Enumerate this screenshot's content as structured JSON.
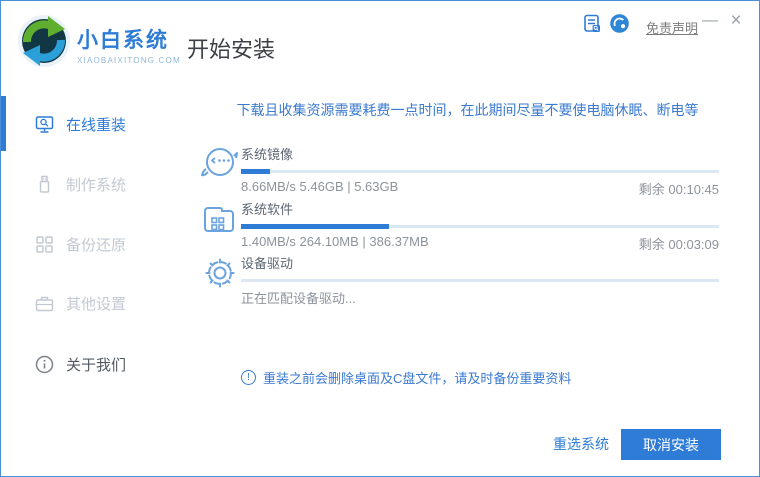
{
  "header": {
    "brand_name": "小白系统",
    "brand_domain": "XIAOBAIXITONG.COM",
    "page_title": "开始安装",
    "disclaimer": "免责声明",
    "minimize": "—",
    "close": "×",
    "icons": {
      "feedback": "document-feedback-icon",
      "service": "customer-service-icon"
    }
  },
  "sidebar": {
    "items": [
      {
        "label": "在线重装",
        "icon": "monitor-reinstall-icon",
        "state": "active"
      },
      {
        "label": "制作系统",
        "icon": "usb-make-system-icon",
        "state": "disabled"
      },
      {
        "label": "备份还原",
        "icon": "backup-restore-icon",
        "state": "disabled"
      },
      {
        "label": "其他设置",
        "icon": "briefcase-settings-icon",
        "state": "disabled"
      },
      {
        "label": "关于我们",
        "icon": "info-about-icon",
        "state": "normal"
      }
    ]
  },
  "main": {
    "notice": "下载且收集资源需要耗费一点时间，在此期间尽量不要使电脑休眠、断电等",
    "tasks": [
      {
        "name": "系统镜像",
        "icon": "mascot-face-icon",
        "progress_percent": 6,
        "detail": "8.66MB/s 5.46GB | 5.63GB",
        "remaining": "剩余 00:10:45"
      },
      {
        "name": "系统软件",
        "icon": "software-folder-icon",
        "progress_percent": 31,
        "detail": "1.40MB/s 264.10MB | 386.37MB",
        "remaining": "剩余 00:03:09"
      },
      {
        "name": "设备驱动",
        "icon": "gear-icon",
        "progress_percent": 0,
        "detail": "正在匹配设备驱动...",
        "remaining": ""
      }
    ],
    "warning_icon": "exclamation-circle-icon",
    "warning": "重装之前会删除桌面及C盘文件，请及时备份重要资料",
    "footer": {
      "reselect": "重选系统",
      "cancel": "取消安装"
    }
  },
  "colors": {
    "accent": "#2e7cd6",
    "notice_blue": "#3a7ad1",
    "progress_track": "#dbe7f3",
    "window_border": "#4a90d9",
    "disabled_gray": "#c3c9d2"
  }
}
